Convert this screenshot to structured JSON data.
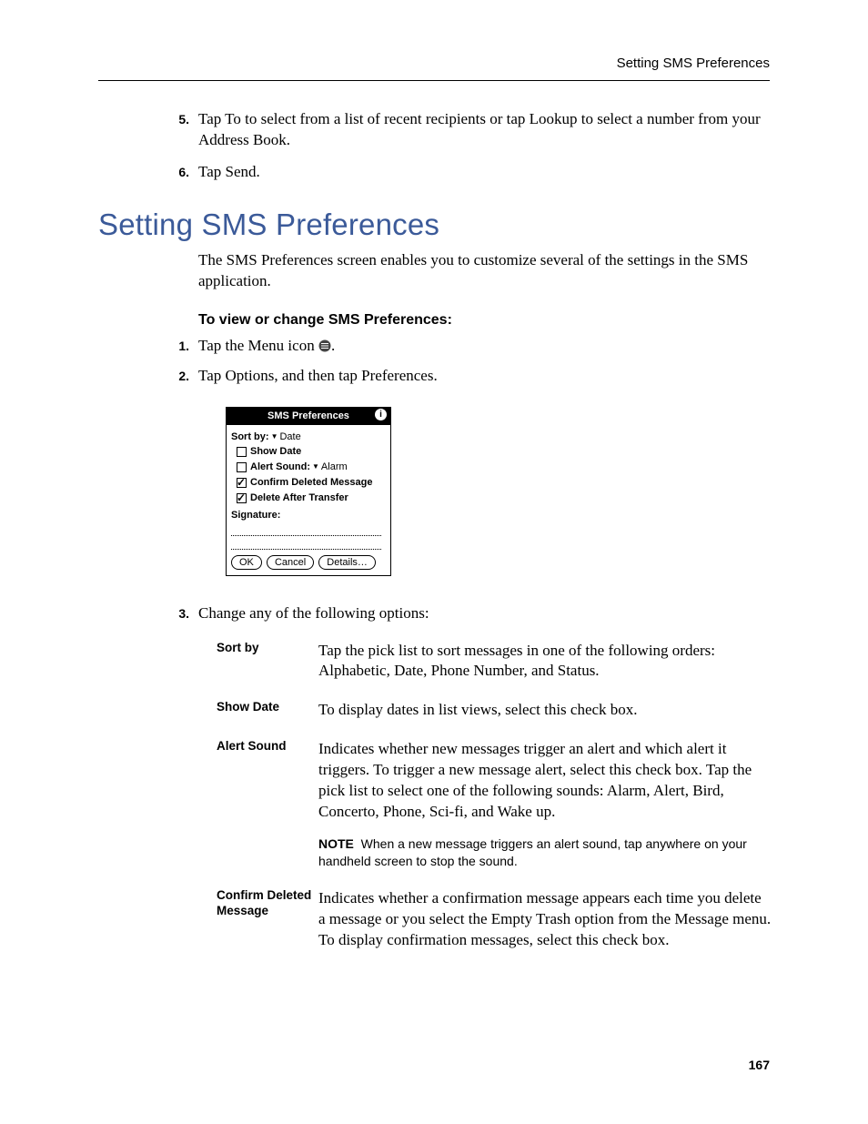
{
  "header": {
    "running_head": "Setting SMS Preferences"
  },
  "steps_top": [
    {
      "n": "5.",
      "text": "Tap To to select from a list of recent recipients or tap Lookup to select a number from your Address Book."
    },
    {
      "n": "6.",
      "text": "Tap Send."
    }
  ],
  "section": {
    "title": "Setting SMS Preferences",
    "intro": "The SMS Preferences screen enables you to customize several of the settings in the SMS application.",
    "subhead": "To view or change SMS Preferences:",
    "steps": [
      {
        "n": "1.",
        "pre": "Tap the Menu icon ",
        "post": "."
      },
      {
        "n": "2.",
        "text": "Tap Options, and then tap Preferences."
      }
    ],
    "step_after_shot": {
      "n": "3.",
      "text": "Change any of the following options:"
    }
  },
  "screenshot": {
    "title": "SMS Preferences",
    "sortby_label": "Sort by:",
    "sortby_value": "Date",
    "rows": [
      {
        "checked": false,
        "label": "Show Date"
      },
      {
        "checked": false,
        "label": "Alert Sound:",
        "value": "Alarm"
      },
      {
        "checked": true,
        "label": "Confirm Deleted Message"
      },
      {
        "checked": true,
        "label": "Delete After Transfer"
      }
    ],
    "signature_label": "Signature:",
    "buttons": [
      "OK",
      "Cancel",
      "Details…"
    ]
  },
  "options": [
    {
      "term": "Sort by",
      "desc": "Tap the pick list to sort messages in one of the following orders: Alphabetic, Date, Phone Number, and Status."
    },
    {
      "term": "Show Date",
      "desc": "To display dates in list views, select this check box."
    },
    {
      "term": "Alert Sound",
      "desc": "Indicates whether new messages trigger an alert and which alert it triggers. To trigger a new message alert, select this check box. Tap the pick list to select one of the following sounds: Alarm, Alert, Bird, Concerto, Phone, Sci-fi, and Wake up.",
      "note_label": "NOTE",
      "note": "When a new message triggers an alert sound, tap anywhere on your handheld screen to stop the sound."
    },
    {
      "term": "Confirm Deleted Message",
      "desc": "Indicates whether a confirmation message appears each time you delete a message or you select the Empty Trash option from the Message menu. To display confirmation messages, select this check box."
    }
  ],
  "page_number": "167"
}
